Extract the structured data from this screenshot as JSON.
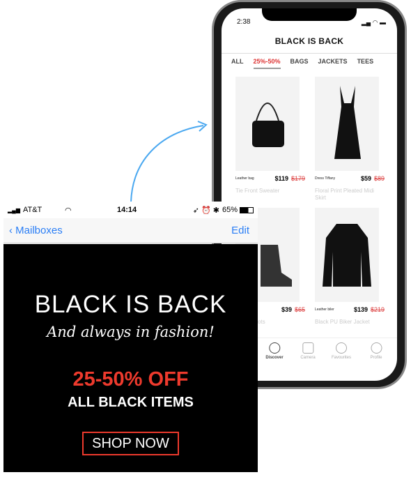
{
  "phone": {
    "time": "2:38",
    "title": "BLACK IS BACK",
    "tabs": [
      "ALL",
      "25%-50%",
      "BAGS",
      "JACKETS",
      "TEES"
    ],
    "active_tab": 1,
    "products": [
      {
        "label": "Leather bag",
        "price": "$119",
        "old_price": "$179",
        "name": "Tie Front Sweater",
        "icon": "handbag"
      },
      {
        "label": "Dress Tiffany",
        "price": "$59",
        "old_price": "$89",
        "name": "Floral Print Pleated Midi Skirt",
        "icon": "dress"
      },
      {
        "label": "",
        "price": "$39",
        "old_price": "$65",
        "name": "Ankle Boots",
        "icon": "boots"
      },
      {
        "label": "Leather biler",
        "price": "$139",
        "old_price": "$219",
        "name": "Black PU Biker Jacket",
        "icon": "jacket"
      }
    ],
    "nav": [
      "Discover",
      "Camera",
      "Favourites",
      "Profile"
    ]
  },
  "email": {
    "carrier": "AT&T",
    "time": "14:14",
    "battery": "65%",
    "back": "Mailboxes",
    "edit": "Edit",
    "ad": {
      "headline": "BLACK IS BACK",
      "subline": "And always in fashion!",
      "offer": "25-50% OFF",
      "items": "ALL BLACK ITEMS",
      "cta": "SHOP NOW"
    }
  },
  "colors": {
    "accent": "#ee3a2d",
    "link": "#2a7ef5",
    "arrow": "#4aa8f0"
  }
}
